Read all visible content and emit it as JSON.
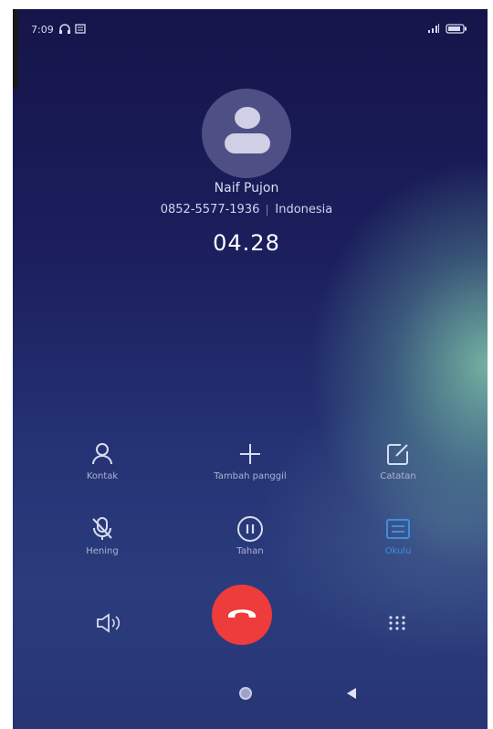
{
  "status_bar": {
    "time": "7:09",
    "icons": [
      "headset-icon",
      "message-icon",
      "signal-icon",
      "battery-icon"
    ]
  },
  "contact": {
    "name": "Naif Pujon",
    "number": "0852-5577-1936",
    "location": "Indonesia"
  },
  "call": {
    "duration": "04.28"
  },
  "actions": [
    {
      "label": "Kontak",
      "icon": "contact-icon"
    },
    {
      "label": "Tambah panggil",
      "icon": "add-call-icon"
    },
    {
      "label": "Catatan",
      "icon": "note-icon"
    },
    {
      "label": "Hening",
      "icon": "mute-icon"
    },
    {
      "label": "Tahan",
      "icon": "hold-icon"
    },
    {
      "label": "Okulu",
      "icon": "record-icon",
      "active": true
    }
  ],
  "controls": {
    "speaker_icon": "speaker-icon",
    "end_call_icon": "end-call-icon",
    "keypad_icon": "keypad-icon"
  },
  "nav": {
    "home_icon": "home-icon",
    "back_icon": "back-icon"
  },
  "colors": {
    "end_call": "#ee3b3b",
    "active_action": "#3a8fe8",
    "background_top": "#15154a"
  }
}
